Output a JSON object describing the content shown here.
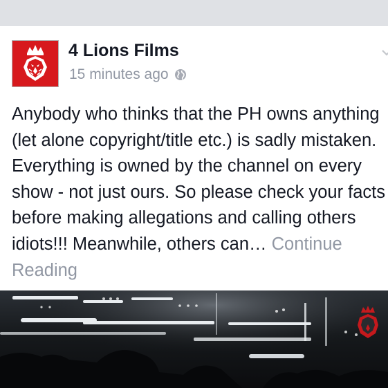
{
  "post": {
    "page_name": "4 Lions Films",
    "timestamp": "15 minutes ago",
    "privacy_icon": "globe-icon",
    "avatar_icon": "lion-crown-logo",
    "body_text": "Anybody who thinks that the PH owns anything (let alone copyright/title etc.) is sadly mistaken. Everything is owned by the channel on every show - not just ours. So please check your facts before making allegations and calling others idiots!!! Meanwhile, others can…",
    "continue_label": "Continue Reading"
  },
  "colors": {
    "brand_red": "#d7191d",
    "text": "#141823",
    "muted": "#9197a3",
    "background": "#e9eaed"
  }
}
